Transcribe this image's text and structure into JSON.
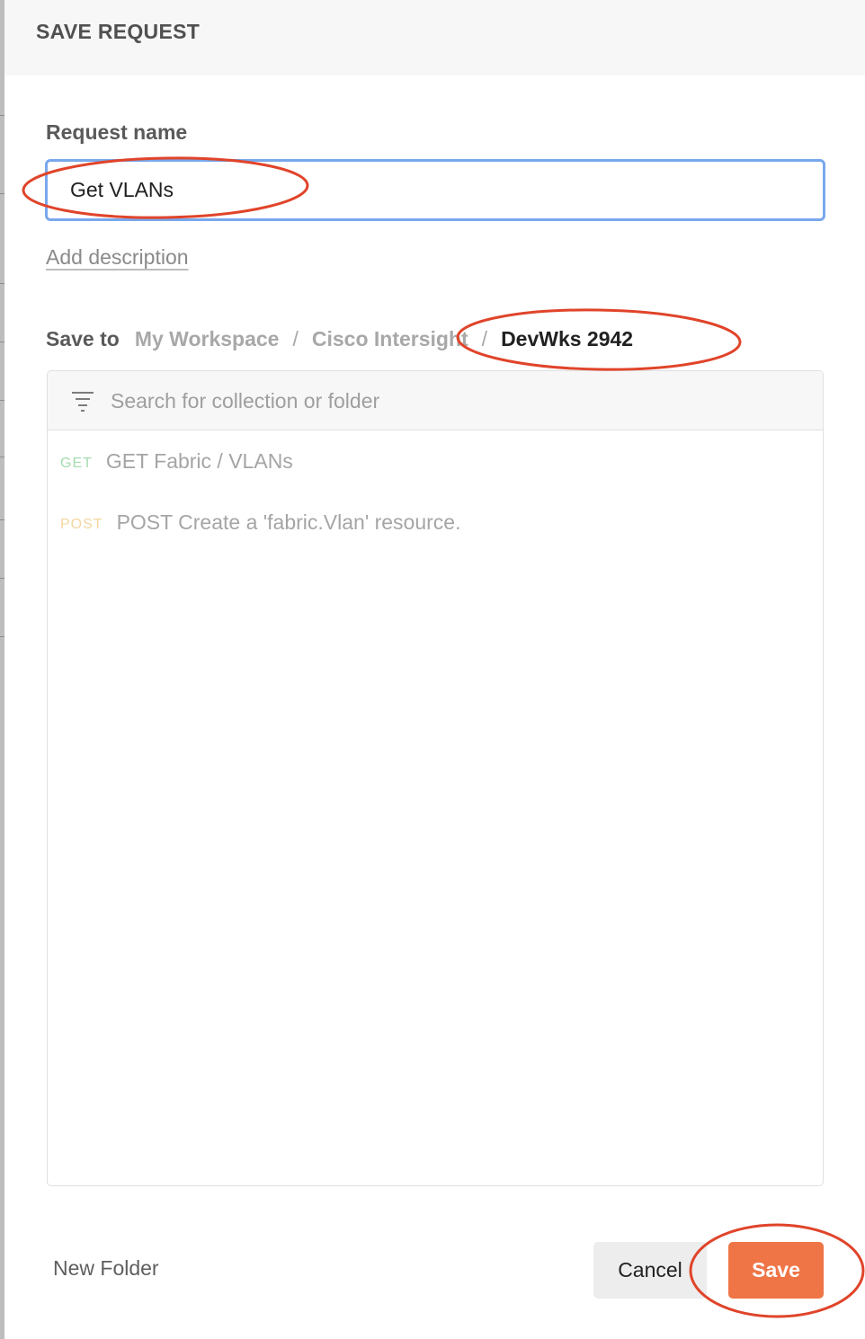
{
  "modal": {
    "title": "SAVE REQUEST"
  },
  "request_name": {
    "label": "Request name",
    "value": "Get VLANs"
  },
  "add_description_label": "Add description",
  "save_to": {
    "label": "Save to",
    "breadcrumb": [
      "My Workspace",
      "Cisco Intersight",
      "DevWks 2942"
    ],
    "separator": "/"
  },
  "collection_search": {
    "placeholder": "Search for collection or folder"
  },
  "requests": [
    {
      "method": "GET",
      "title": "GET Fabric / VLANs"
    },
    {
      "method": "POST",
      "title": "POST Create a 'fabric.Vlan' resource."
    }
  ],
  "footer": {
    "new_folder_label": "New Folder",
    "cancel_label": "Cancel",
    "save_label": "Save"
  },
  "colors": {
    "accent": "#ef7547",
    "input_focus_border": "#79a8ec",
    "get_method": "#a4dcae",
    "post_method": "#f3d7a1",
    "annotation_ring": "#e0442a"
  },
  "icons": {
    "filter": "filter-icon"
  }
}
